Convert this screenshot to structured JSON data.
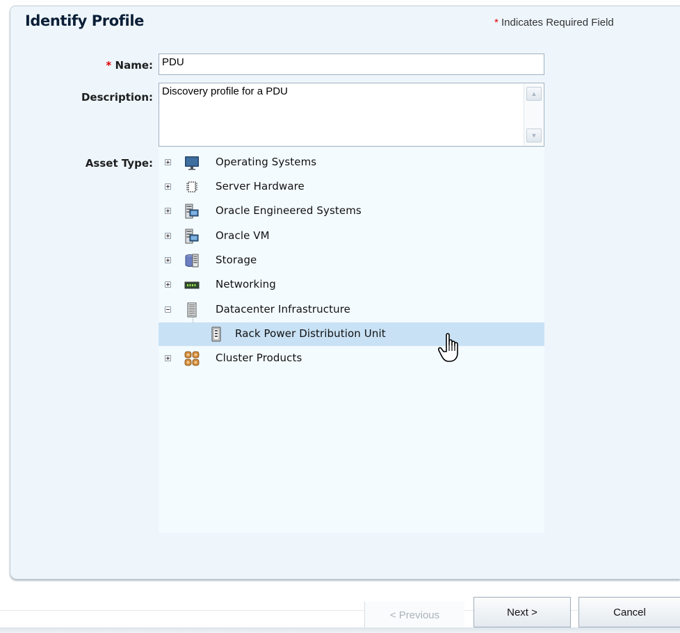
{
  "header": {
    "title": "Identify Profile",
    "required_star": "*",
    "required_note": "Indicates Required Field"
  },
  "form": {
    "name_star": "*",
    "name_label": "Name:",
    "name_value": "PDU",
    "description_label": "Description:",
    "description_value": "Discovery profile for a PDU",
    "asset_type_label": "Asset Type:"
  },
  "tree": {
    "items": [
      {
        "label": "Operating Systems",
        "icon": "monitor-icon",
        "expanded": false
      },
      {
        "label": "Server Hardware",
        "icon": "chip-icon",
        "expanded": false
      },
      {
        "label": "Oracle Engineered Systems",
        "icon": "system-rack-icon",
        "expanded": false
      },
      {
        "label": "Oracle VM",
        "icon": "vm-rack-icon",
        "expanded": false
      },
      {
        "label": "Storage",
        "icon": "storage-icon",
        "expanded": false
      },
      {
        "label": "Networking",
        "icon": "network-switch-icon",
        "expanded": false
      },
      {
        "label": "Datacenter Infrastructure",
        "icon": "datacenter-rack-icon",
        "expanded": true
      },
      {
        "label": "Rack Power Distribution Unit",
        "icon": "pdu-icon",
        "selected": true
      },
      {
        "label": "Cluster Products",
        "icon": "cluster-icon",
        "expanded": false
      }
    ]
  },
  "buttons": {
    "previous": "< Previous",
    "next": "Next >",
    "cancel": "Cancel"
  },
  "colors": {
    "panel_bg": "#eef6fc",
    "tree_bg": "#f4fbff",
    "selected_row": "#c8e1f5",
    "required_star": "#e00000"
  }
}
